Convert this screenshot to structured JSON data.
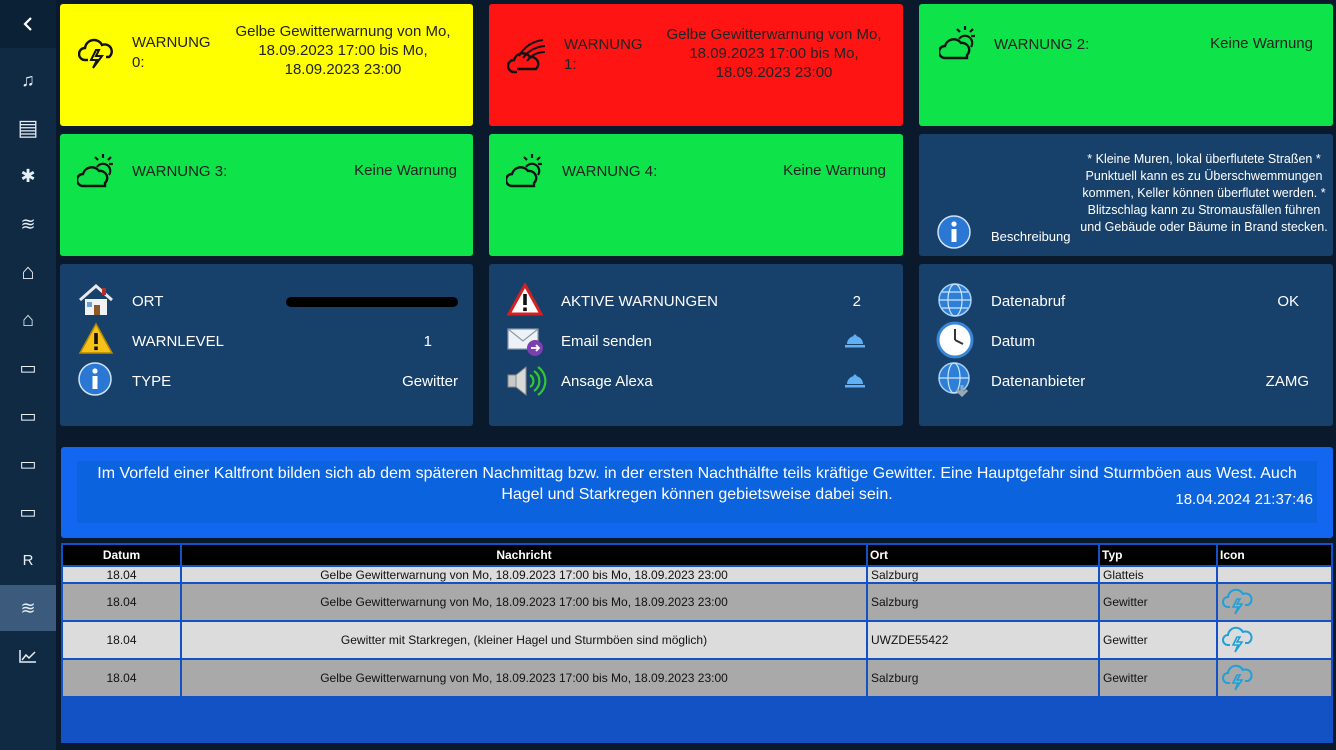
{
  "sidebar": {
    "items": [
      {
        "name": "music-icon",
        "glyph": "♫"
      },
      {
        "name": "window-icon",
        "glyph": "▤"
      },
      {
        "name": "network-icon",
        "glyph": "✱"
      },
      {
        "name": "weather-icon",
        "glyph": "≋"
      },
      {
        "name": "house-icon",
        "glyph": "⌂"
      },
      {
        "name": "home-outline-icon",
        "glyph": "⌂"
      },
      {
        "name": "device-icon-1",
        "glyph": "▭"
      },
      {
        "name": "device-icon-2",
        "glyph": "▭"
      },
      {
        "name": "keyboard-icon",
        "glyph": "▭"
      },
      {
        "name": "device-icon-3",
        "glyph": "▭"
      },
      {
        "name": "letter-r",
        "glyph": "R"
      },
      {
        "name": "weather-active-icon",
        "glyph": "≋"
      },
      {
        "name": "chart-icon",
        "glyph": "📈"
      }
    ]
  },
  "warnings": {
    "w0": {
      "label": "WARNUNG 0:",
      "text": "Gelbe Gewitterwarnung von Mo, 18.09.2023 17:00 bis Mo, 18.09.2023 23:00"
    },
    "w1": {
      "label": "WARNUNG 1:",
      "text": "Gelbe Gewitterwarnung von Mo, 18.09.2023 17:00 bis Mo, 18.09.2023 23:00"
    },
    "w2": {
      "label": "WARNUNG 2:",
      "text": "Keine Warnung"
    },
    "w3": {
      "label": "WARNUNG 3:",
      "text": "Keine Warnung"
    },
    "w4": {
      "label": "WARNUNG 4:",
      "text": "Keine Warnung"
    }
  },
  "beschreibung": {
    "label": "Beschreibung",
    "text": "* Kleine Muren, lokal überflutete Straßen * Punktuell kann es zu Überschwemmungen kommen, Keller können überflutet werden. * Blitzschlag kann zu Stromausfällen führen und Gebäude oder Bäume in Brand stecken."
  },
  "info": {
    "ort_label": "ORT",
    "warnlevel_label": "WARNLEVEL",
    "warnlevel_value": "1",
    "type_label": "TYPE",
    "type_value": "Gewitter"
  },
  "actions": {
    "aktive_label": "AKTIVE WARNUNGEN",
    "aktive_value": "2",
    "email_label": "Email senden",
    "alexa_label": "Ansage Alexa"
  },
  "data_status": {
    "abruf_label": "Datenabruf",
    "abruf_value": "OK",
    "datum_label": "Datum",
    "anbieter_label": "Datenanbieter",
    "anbieter_value": "ZAMG"
  },
  "banner": {
    "text": "Im Vorfeld einer Kaltfront bilden sich ab dem späteren Nachmittag bzw. in der ersten Nachthälfte teils kräftige Gewitter. Eine Hauptgefahr sind Sturmböen aus West. Auch Hagel und Starkregen können gebietsweise dabei sein.",
    "timestamp": "18.04.2024 21:37:46"
  },
  "table": {
    "headers": [
      "Datum",
      "Nachricht",
      "Ort",
      "Typ",
      "Icon"
    ],
    "rows": [
      {
        "datum": "18.04",
        "nachricht": "Gelbe Gewitterwarnung von Mo, 18.09.2023 17:00 bis Mo, 18.09.2023 23:00",
        "ort": "Salzburg",
        "typ": "Glatteis",
        "icon": ""
      },
      {
        "datum": "18.04",
        "nachricht": "Gelbe Gewitterwarnung von Mo, 18.09.2023 17:00 bis Mo, 18.09.2023 23:00",
        "ort": "Salzburg",
        "typ": "Gewitter",
        "icon": "thunder-cloud-icon"
      },
      {
        "datum": "18.04",
        "nachricht": "Gewitter mit Starkregen, (kleiner Hagel und Sturmböen sind möglich)",
        "ort": "UWZDE55422",
        "typ": "Gewitter",
        "icon": "thunder-cloud-icon"
      },
      {
        "datum": "18.04",
        "nachricht": "Gelbe Gewitterwarnung von Mo, 18.09.2023 17:00 bis Mo, 18.09.2023 23:00",
        "ort": "Salzburg",
        "typ": "Gewitter",
        "icon": "thunder-cloud-icon"
      }
    ]
  },
  "colors": {
    "yellow": "#ffff00",
    "red": "#ff1414",
    "green": "#0fe34a",
    "navy": "#17406b",
    "banner": "#1366f0"
  }
}
